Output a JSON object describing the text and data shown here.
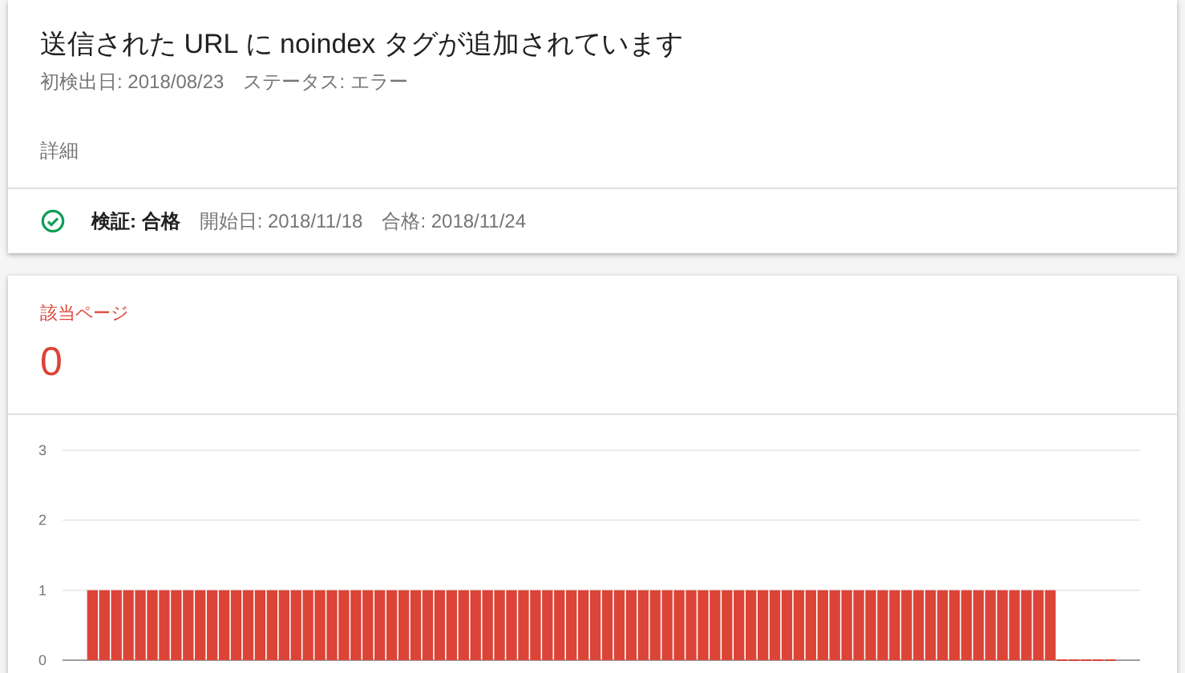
{
  "issue": {
    "title": "送信された URL に noindex タグが追加されています",
    "first_detected": "初検出日: 2018/08/23",
    "status": "ステータス: エラー",
    "details_link": "詳細"
  },
  "validation": {
    "passed": true,
    "label": "検証: 合格",
    "started": "開始日: 2018/11/18",
    "passed_date": "合格: 2018/11/24"
  },
  "summary": {
    "label": "該当ページ",
    "value": "0"
  },
  "chart_data": {
    "type": "bar",
    "yticks": [
      0,
      1,
      2,
      3
    ],
    "ylim": [
      0,
      3
    ],
    "values": [
      null,
      null,
      1,
      1,
      1,
      1,
      1,
      1,
      1,
      1,
      1,
      1,
      1,
      1,
      1,
      1,
      1,
      1,
      1,
      1,
      1,
      1,
      1,
      1,
      1,
      1,
      1,
      1,
      1,
      1,
      1,
      1,
      1,
      1,
      1,
      1,
      1,
      1,
      1,
      1,
      1,
      1,
      1,
      1,
      1,
      1,
      1,
      1,
      1,
      1,
      1,
      1,
      1,
      1,
      1,
      1,
      1,
      1,
      1,
      1,
      1,
      1,
      1,
      1,
      1,
      1,
      1,
      1,
      1,
      1,
      1,
      1,
      1,
      1,
      1,
      1,
      1,
      1,
      1,
      1,
      1,
      1,
      1,
      0,
      0,
      0,
      0,
      0,
      null,
      null
    ]
  }
}
